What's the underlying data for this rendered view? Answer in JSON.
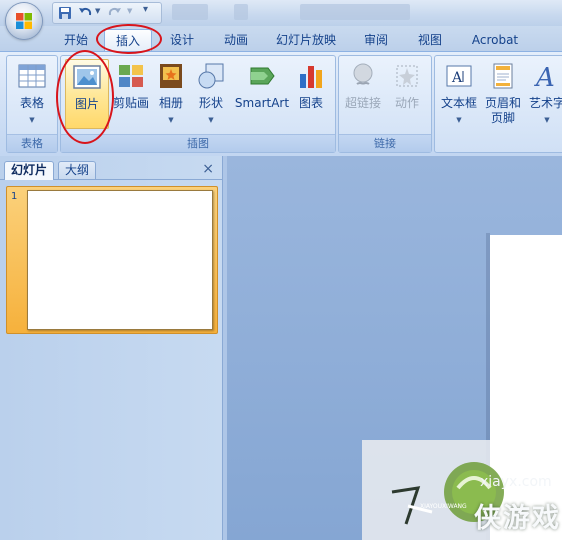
{
  "tabs": [
    "开始",
    "插入",
    "设计",
    "动画",
    "幻灯片放映",
    "审阅",
    "视图",
    "Acrobat"
  ],
  "active_tab": "插入",
  "ribbon": {
    "table_group": {
      "label": "表格",
      "buttons": {
        "table": "表格"
      }
    },
    "illustrations_group": {
      "label": "插图",
      "buttons": {
        "picture": "图片",
        "clipart": "剪贴画",
        "album": "相册",
        "shapes": "形状",
        "smartart": "SmartArt",
        "chart": "图表"
      }
    },
    "links_group": {
      "label": "链接",
      "buttons": {
        "hyperlink": "超链接",
        "action": "动作"
      }
    },
    "text_group": {
      "buttons": {
        "textbox": "文本框",
        "header_footer_1": "页眉和",
        "header_footer_2": "页脚",
        "wordart": "艺术字"
      }
    }
  },
  "panel": {
    "tab_slides": "幻灯片",
    "tab_outline": "大纲",
    "close": "×",
    "thumbnail_number": "1"
  },
  "watermark": {
    "site": "xiayx.com",
    "name": "侠游戏",
    "pinyin": "XIAYOUXIWANG"
  },
  "colors": {
    "ribbon_text": "#15428b",
    "highlight_circle": "#d8141b",
    "hot_button": "#ffd86a",
    "selected_thumb": "#f6b13c"
  }
}
